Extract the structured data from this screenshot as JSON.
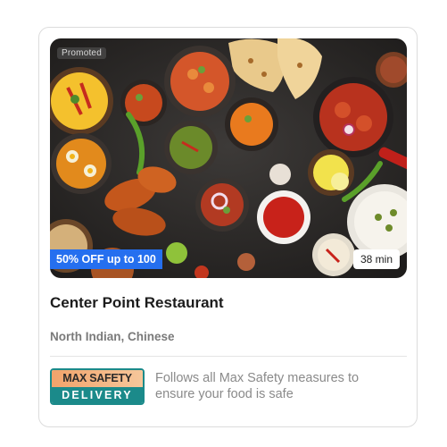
{
  "card": {
    "promoted_label": "Promoted",
    "discount_text": "50% OFF up to 100",
    "delivery_time": "38 min",
    "restaurant_name": "Center Point Restaurant",
    "cuisines": "North Indian, Chinese",
    "safety_badge_top": "MAX SAFETY",
    "safety_badge_bottom": "DELIVERY",
    "safety_text": "Follows all Max Safety measures to ensure your food is safe"
  },
  "colors": {
    "discount_bg": "#256fef",
    "badge_teal": "#1b8a8a",
    "badge_orange": "#f1a36b"
  },
  "image": {
    "description_icon": "food-spread-image"
  }
}
